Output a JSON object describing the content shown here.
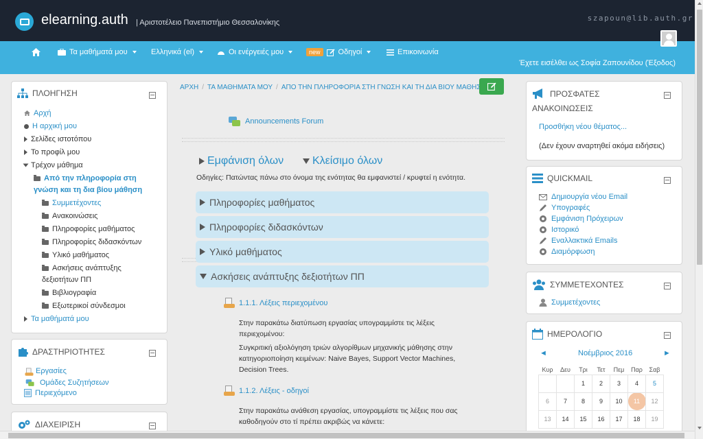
{
  "header": {
    "brand": "elearning.auth",
    "subtitle": "| Αριστοτέλειο Πανεπιστήμιο Θεσσαλονίκης",
    "user_email": "szapoun@lib.auth.gr"
  },
  "nav": {
    "home_icon": "home-icon",
    "my_courses": "Τα μαθήματά μου",
    "language": "Ελληνικά (el)",
    "my_actions": "Οι ενέργειές μου",
    "new_badge": "new",
    "guides": "Οδηγοί",
    "contact": "Επικοινωνία",
    "logged_in": "Έχετε εισέλθει ως Σοφία Ζαπουνίδου (Έξοδος)"
  },
  "navigation_block": {
    "title": "ΠΛΟΗΓΗΣΗ",
    "home": "Αρχή",
    "my_home": "Η αρχική μου",
    "site_pages": "Σελίδες ιστοτόπου",
    "my_profile": "Το προφίλ μου",
    "current_course": "Τρέχον μάθημα",
    "course_name_1": "Από την πληροφορία στη",
    "course_name_2": "γνώση και τη δια βίου μάθηση",
    "children": [
      "Συμμετέχοντες",
      "Ανακοινώσεις",
      "Πληροφορίες μαθήματος",
      "Πληροφορίες διδασκόντων",
      "Υλικό μαθήματος"
    ],
    "skills_1": "Ασκήσεις ανάπτυξης",
    "skills_2": "δεξιοτήτων ΠΠ",
    "bibliography": "Βιβλιογραφία",
    "external_links": "Εξωτερικοί σύνδεσμοι",
    "my_courses": "Τα μαθήματά μου"
  },
  "activities_block": {
    "title": "ΔΡΑΣΤΗΡΙΟΤΗΤΕΣ",
    "items": [
      "Εργασίες",
      "Ομάδες Συζητήσεων",
      "Περιεχόμενο"
    ]
  },
  "admin_block": {
    "title": "ΔΙΑΧΕΙΡΙΣΗ"
  },
  "breadcrumb": {
    "home": "ΑΡΧΗ",
    "my_courses": "ΤΑ ΜΑΘΗΜΑΤΑ ΜΟΥ",
    "course": "ΑΠΟ ΤΗΝ ΠΛΗΡΟΦΟΡΙΑ ΣΤΗ ΓΝΩΣΗ ΚΑΙ ΤΗ ΔΙΑ ΒΙΟΥ ΜΑΘΗΣΗ"
  },
  "main": {
    "forum_link": "Announcements Forum",
    "show_all": "Εμφάνιση όλων",
    "close_all": "Κλείσιμο όλων",
    "hint": "Οδηγίες: Πατώντας πάνω στο όνομα της ενότητας θα εμφανιστεί / κρυφτεί η ενότητα.",
    "sections": [
      "Πληροφορίες μαθήματος",
      "Πληροφορίες διδασκόντων",
      "Υλικό μαθήματος",
      "Ασκήσεις ανάπτυξης δεξιοτήτων ΠΠ"
    ],
    "activity1": {
      "title": "1.1.1. Λέξεις περιεχομένου",
      "line1": "Στην παρακάτω διατύπωση εργασίας υπογραμμίστε τις λέξεις",
      "line2": "περιεχομένου:",
      "line3": "Συγκριτική αξιολόγηση τριών αλγορίθμων μηχανικής μάθησης στην",
      "line4": "κατηγοριοποίηση κειμένων: Naive Bayes, Support Vector Machines,",
      "line5": "Decision Trees."
    },
    "activity2": {
      "title": "1.1.2. Λέξεις - οδηγοί",
      "line1": "Στην παρακάτω ανάθεση εργασίας, υπογραμμίστε τις λέξεις που σας",
      "line2": "καθοδηγούν στο τί πρέπει ακριβώς να κάνετε:"
    }
  },
  "announcements_block": {
    "title_1": "ΠΡΟΣΦΑΤΕΣ",
    "title_2": "ΑΝΑΚΟΙΝΩΣΕΙΣ",
    "add_topic": "Προσθήκη νέου θέματος...",
    "empty": "(Δεν έχουν αναρτηθεί ακόμα ειδήσεις)"
  },
  "quickmail_block": {
    "title": "QUICKMAIL",
    "items": [
      "Δημιουργία νέου Email",
      "Υπογραφές",
      "Εμφάνιση Πρόχειρων",
      "Ιστορικό",
      "Εναλλακτικά Emails",
      "Διαμόρφωση"
    ]
  },
  "participants_block": {
    "title": "ΣΥΜΜΕΤΕΧΟΝΤΕΣ",
    "link": "Συμμετέχοντες"
  },
  "calendar_block": {
    "title": "ΗΜΕΡΟΛΟΓΙΟ",
    "month": "Νοέμβριος 2016",
    "prev": "◄",
    "next": "►",
    "weekdays": [
      "Κυρ",
      "Δευ",
      "Τρι",
      "Τετ",
      "Πεμ",
      "Παρ",
      "Σαβ"
    ],
    "rows": [
      [
        "",
        "",
        "1",
        "2",
        "3",
        "4",
        "5"
      ],
      [
        "6",
        "7",
        "8",
        "9",
        "10",
        "11",
        "12"
      ],
      [
        "13",
        "14",
        "15",
        "16",
        "17",
        "18",
        "19"
      ]
    ],
    "today": "11"
  }
}
